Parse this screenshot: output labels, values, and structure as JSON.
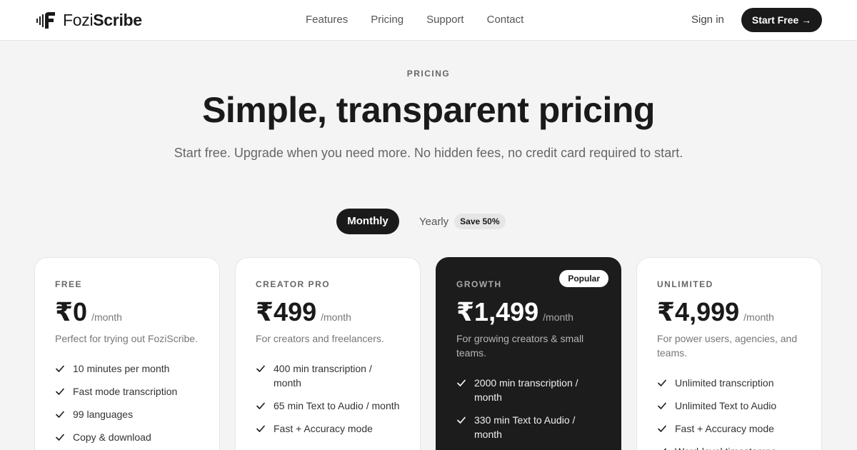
{
  "brand": {
    "name_light": "Fozi",
    "name_bold": "Scribe",
    "logo_icon": "soundwave-f-logo-icon"
  },
  "nav": {
    "items": [
      "Features",
      "Pricing",
      "Support",
      "Contact"
    ]
  },
  "header": {
    "signin_label": "Sign in",
    "cta_label": "Start Free →"
  },
  "hero": {
    "eyebrow": "PRICING",
    "title": "Simple, transparent pricing",
    "subtitle": "Start free. Upgrade when you need more. No hidden fees, no credit card required to start."
  },
  "billing_toggle": {
    "monthly_label": "Monthly",
    "yearly_label": "Yearly",
    "yearly_badge": "Save 50%",
    "selected": "Monthly"
  },
  "plans": [
    {
      "tier": "FREE",
      "price": "₹0",
      "period": "/month",
      "description": "Perfect for trying out FoziScribe.",
      "features": [
        "10 minutes per month",
        "Fast mode transcription",
        "99 languages",
        "Copy & download"
      ]
    },
    {
      "tier": "CREATOR PRO",
      "price": "₹499",
      "period": "/month",
      "description": "For creators and freelancers.",
      "features": [
        "400 min transcription / month",
        "65 min Text to Audio / month",
        "Fast + Accuracy mode"
      ]
    },
    {
      "tier": "GROWTH",
      "price": "₹1,499",
      "period": "/month",
      "badge": "Popular",
      "description": "For growing creators & small teams.",
      "features": [
        "2000 min transcription / month",
        "330 min Text to Audio / month"
      ]
    },
    {
      "tier": "UNLIMITED",
      "price": "₹4,999",
      "period": "/month",
      "description": "For power users, agencies, and teams.",
      "features": [
        "Unlimited transcription",
        "Unlimited Text to Audio",
        "Fast + Accuracy mode",
        "Word-level timestamps"
      ]
    }
  ],
  "colors": {
    "primary": "#1a1a1a",
    "background": "#f4f4f4",
    "card": "#ffffff",
    "muted_text": "#666666"
  }
}
